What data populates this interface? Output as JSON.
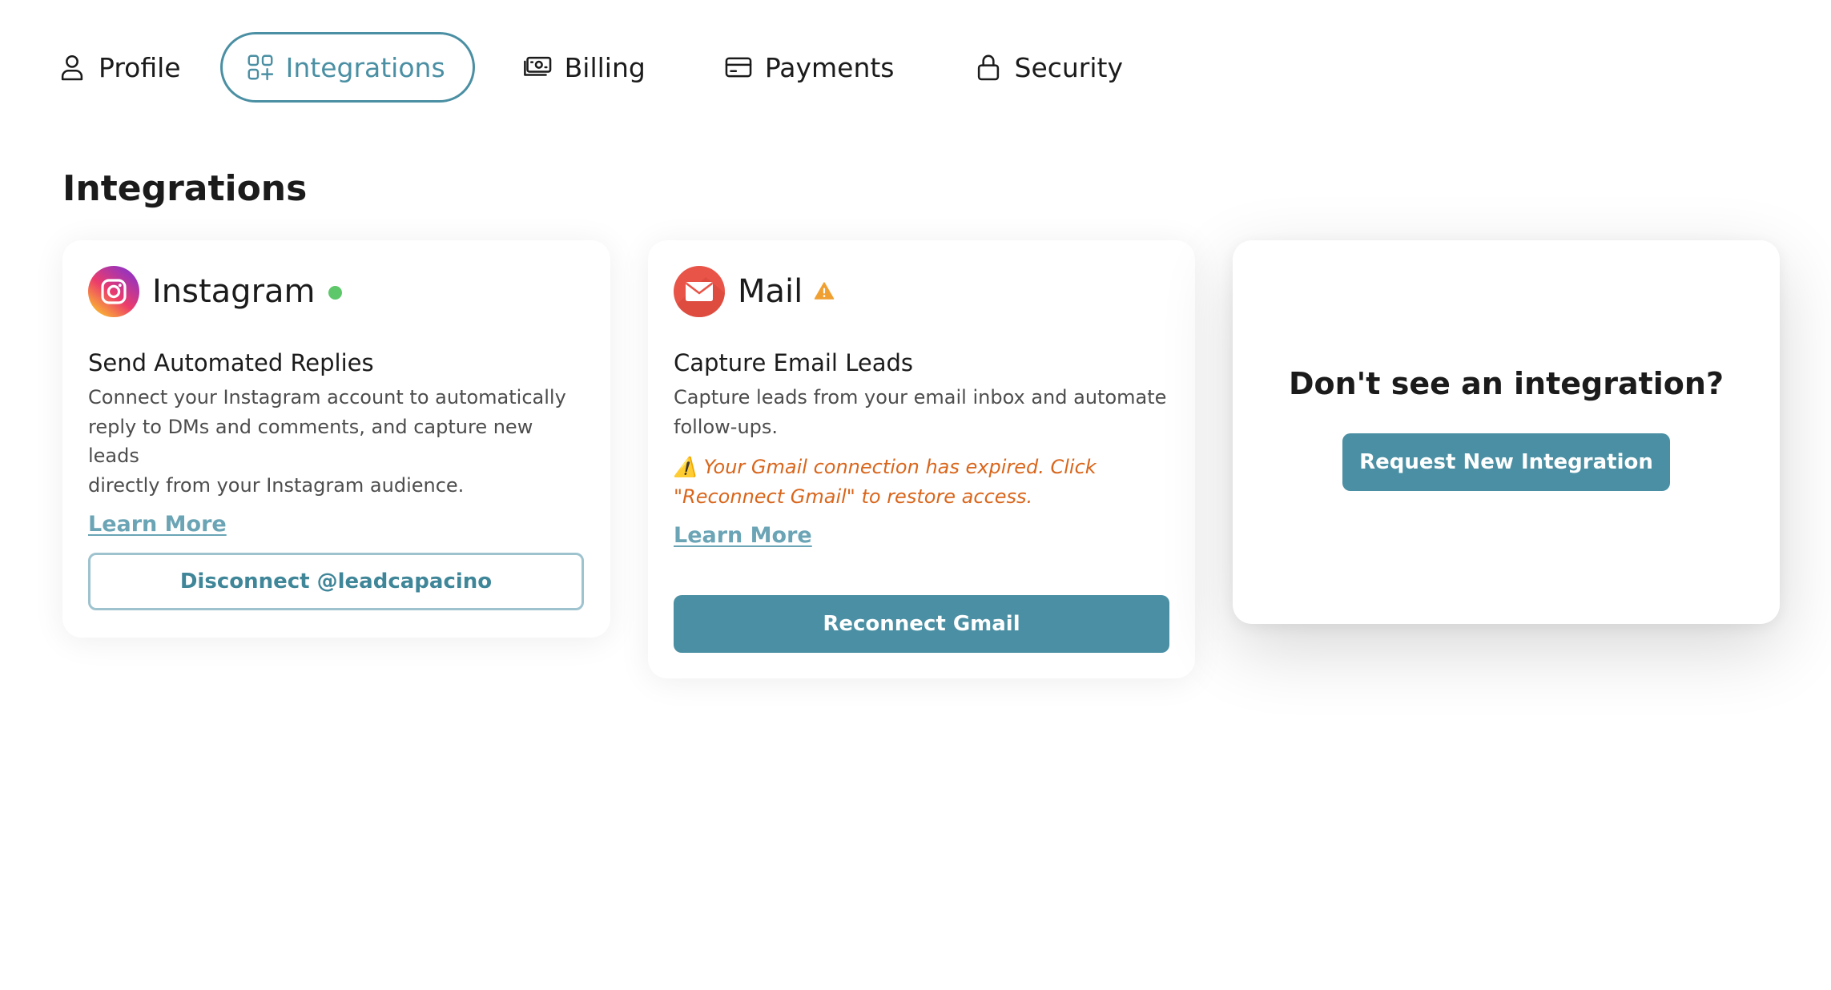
{
  "colors": {
    "accent": "#4a8fa3",
    "status_connected": "#5dc76a",
    "warning": "#d9661c",
    "warning_icon": "#f0a030"
  },
  "tabs": [
    {
      "label": "Profile",
      "icon": "user-icon",
      "active": false
    },
    {
      "label": "Integrations",
      "icon": "grid-plus-icon",
      "active": true
    },
    {
      "label": "Billing",
      "icon": "banknote-icon",
      "active": false
    },
    {
      "label": "Payments",
      "icon": "credit-card-icon",
      "active": false
    },
    {
      "label": "Security",
      "icon": "lock-icon",
      "active": false
    }
  ],
  "page": {
    "title": "Integrations"
  },
  "integrations": {
    "instagram": {
      "name": "Instagram",
      "icon": "instagram-icon",
      "status": "connected",
      "subtitle": "Send Automated Replies",
      "description_lines": [
        "Connect your Instagram account to automatically",
        "reply to DMs and comments, and capture new leads",
        "directly from your Instagram audience."
      ],
      "learn_more": "Learn More",
      "action_label": "Disconnect @leadcapacino"
    },
    "mail": {
      "name": "Mail",
      "icon": "mail-icon",
      "status": "warning",
      "subtitle": "Capture Email Leads",
      "description_lines": [
        "Capture leads from your email inbox and automate",
        "follow-ups."
      ],
      "warning_lines": [
        "⚠️ Your Gmail connection has expired. Click",
        "\"Reconnect Gmail\" to restore access."
      ],
      "learn_more": "Learn More",
      "action_label": "Reconnect Gmail"
    },
    "request": {
      "title": "Don't see an integration?",
      "action_label": "Request New Integration"
    }
  }
}
